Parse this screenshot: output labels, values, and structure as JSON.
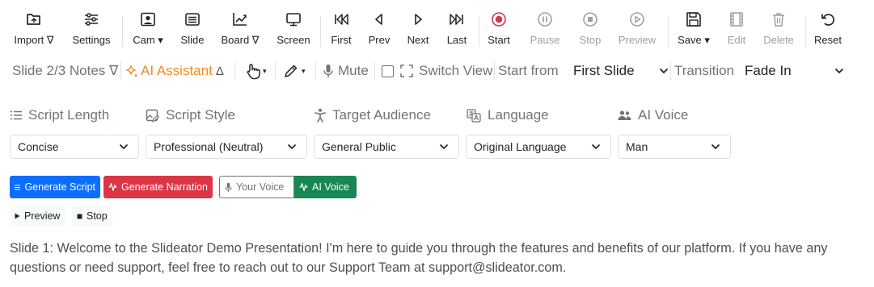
{
  "toolbar": {
    "import": "Import ∇",
    "settings": "Settings",
    "cam": "Cam",
    "slide": "Slide",
    "board": "Board ∇",
    "screen": "Screen",
    "first": "First",
    "prev": "Prev",
    "next": "Next",
    "last": "Last",
    "start": "Start",
    "pause": "Pause",
    "stop": "Stop",
    "preview": "Preview",
    "save": "Save",
    "edit": "Edit",
    "delete": "Delete",
    "reset": "Reset"
  },
  "bar2": {
    "notes": "Slide 2/3 Notes ∇",
    "ai_assistant": "AI Assistant",
    "ai_assistant_caret": "Δ",
    "mute": "Mute",
    "switch_view": "Switch View",
    "start_from_label": "Start from",
    "start_from_value": "First Slide",
    "transition_label": "Transition",
    "transition_value": "Fade In"
  },
  "options": {
    "script_length": {
      "label": "Script Length",
      "value": "Concise"
    },
    "script_style": {
      "label": "Script Style",
      "value": "Professional (Neutral)"
    },
    "target_audience": {
      "label": "Target Audience",
      "value": "General Public"
    },
    "language": {
      "label": "Language",
      "value": "Original Language"
    },
    "ai_voice": {
      "label": "AI Voice",
      "value": "Man"
    }
  },
  "actions": {
    "generate_script": "Generate Script",
    "generate_narration": "Generate Narration",
    "your_voice": "Your Voice",
    "ai_voice": "AI Voice",
    "preview": "Preview",
    "stop": "Stop"
  },
  "script_text": "Slide 1: Welcome to the Slideator Demo Presentation! I'm here to guide you through the features and benefits of our platform. If you have any questions or need support, feel free to reach out to our Support Team at support@slideator.com.",
  "colors": {
    "accent_blue": "#0d6efd",
    "danger_red": "#dc3545",
    "success_green": "#198754",
    "ai_orange": "#f08a24",
    "record_red": "#dc3545"
  }
}
